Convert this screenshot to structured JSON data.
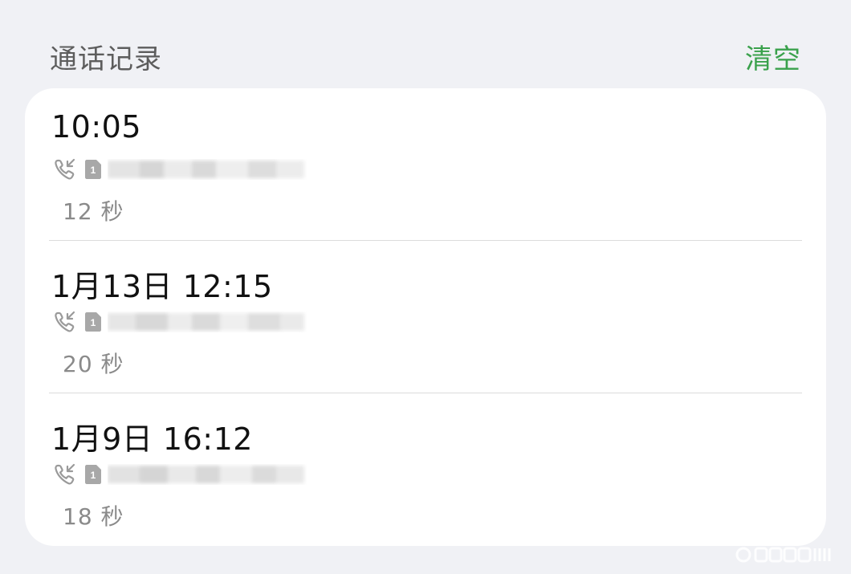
{
  "header": {
    "title": "通话记录",
    "clear_label": "清空"
  },
  "colors": {
    "accent": "#3aa14c",
    "background": "#f0f1f5",
    "card": "#ffffff",
    "primary_text": "#111111",
    "secondary_text": "#8a8a8a"
  },
  "calls": [
    {
      "time": "10:05",
      "direction_icon": "incoming-call-icon",
      "sim_label": "1",
      "number": "",
      "duration": "12 秒"
    },
    {
      "time": "1月13日 12:15",
      "direction_icon": "incoming-call-icon",
      "sim_label": "1",
      "number": "",
      "duration": "20 秒"
    },
    {
      "time": "1月9日 16:12",
      "direction_icon": "incoming-call-icon",
      "sim_label": "1",
      "number": "",
      "duration": "18 秒"
    }
  ]
}
